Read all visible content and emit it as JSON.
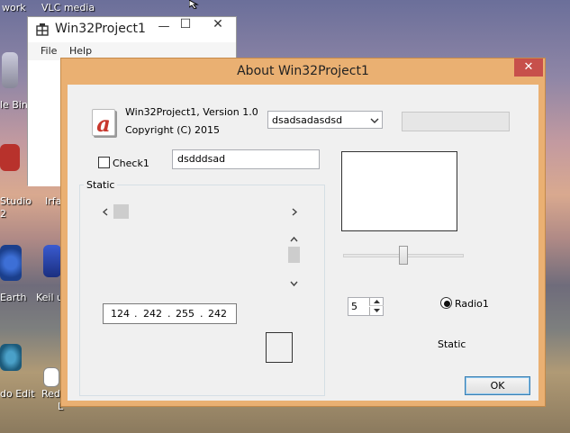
{
  "desktop": {
    "labels": [
      "work",
      "VLC media",
      "le Bin",
      "Studio",
      "2",
      "Irfa",
      "Earth",
      "Keil u",
      "do Edit",
      "Red",
      "L"
    ]
  },
  "main_window": {
    "title": "Win32Project1",
    "menu": [
      "File",
      "Help"
    ],
    "controls": {
      "minimize": "—",
      "maximize": "☐",
      "close": "✕"
    }
  },
  "dialog": {
    "title": "About Win32Project1",
    "close": "✕",
    "app_icon_letter": "a",
    "version_text": "Win32Project1, Version 1.0",
    "copyright_text": "Copyright (C) 2015",
    "combo_value": "dsadsadasdsd",
    "checkbox_label": "Check1",
    "edit_value": "dsdddsad",
    "group_label": "Static",
    "ip_address": [
      "124",
      "242",
      "255",
      "242"
    ],
    "ip_dot": ".",
    "spin_value": "5",
    "radio_label": "Radio1",
    "static_label": "Static",
    "ok_label": "OK",
    "trackbar_position": 0.5,
    "accent_color": "#eab072",
    "close_color": "#c7504b"
  }
}
